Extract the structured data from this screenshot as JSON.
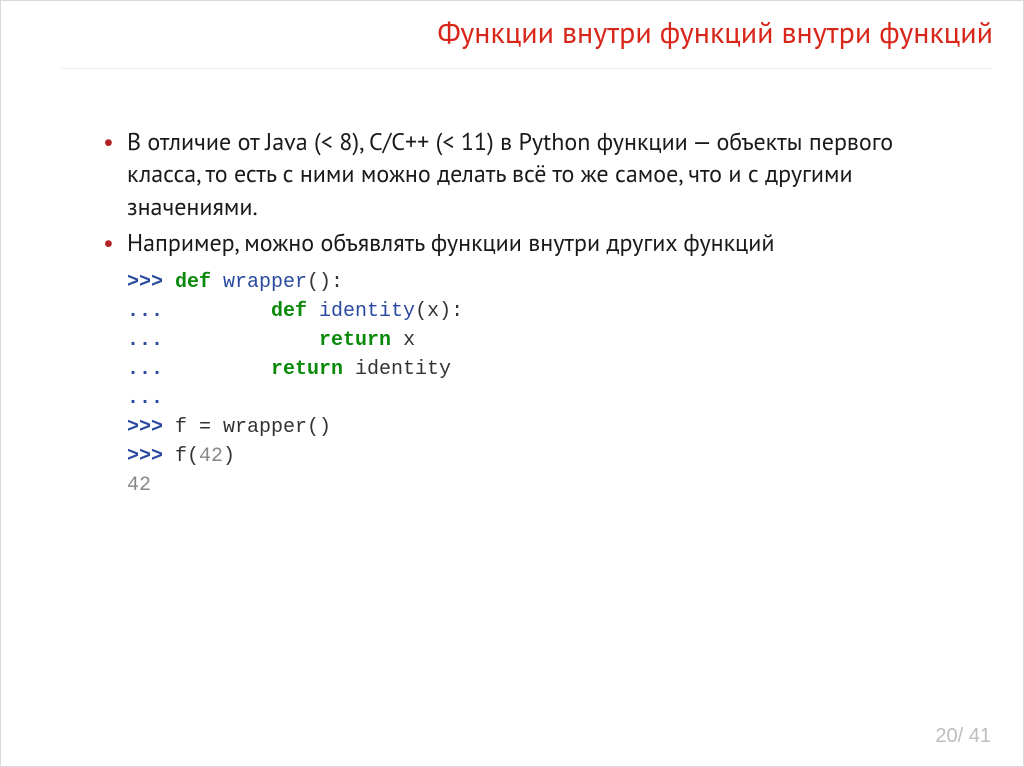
{
  "title": "Функции внутри функций внутри функций",
  "bullets": [
    "В отличие от Java (< 8), C/C++ (< 11) в Python функции — объекты первого класса, то есть с ними можно делать всё то же самое, что и с другими значениями.",
    "Например, можно объявлять функции внутри других функций"
  ],
  "code": {
    "l1": {
      "prompt": ">>> ",
      "kw": "def ",
      "name": "wrapper",
      "paren": "():"
    },
    "l2": {
      "prompt": "... ",
      "indent": "        ",
      "kw": "def ",
      "name": "identity",
      "paren": "(x):"
    },
    "l3": {
      "prompt": "... ",
      "indent": "            ",
      "kw": "return ",
      "var": "x"
    },
    "l4": {
      "prompt": "... ",
      "indent": "        ",
      "kw": "return ",
      "var": "identity"
    },
    "l5": {
      "prompt": "... "
    },
    "l6": {
      "prompt": ">>> ",
      "text": "f = wrapper()"
    },
    "l7": {
      "prompt": ">>> ",
      "text1": "f(",
      "num": "42",
      "text2": ")"
    },
    "l8": {
      "out": "42"
    }
  },
  "pager": "20/ 41"
}
